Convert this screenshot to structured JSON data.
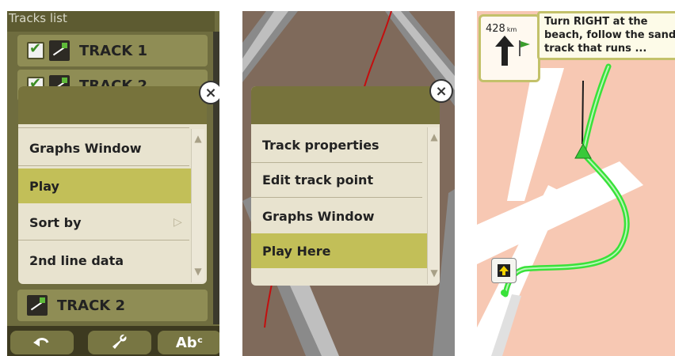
{
  "panel1": {
    "tracks_list_title": "Tracks list",
    "tracks": [
      {
        "label": "TRACK 1",
        "checked": true
      },
      {
        "label": "TRACK 2",
        "checked": true
      },
      {
        "label": "TRACK 2",
        "checked": false
      }
    ],
    "menu": {
      "items": [
        "Graphs Window",
        "Play",
        "Sort by",
        "2nd line data"
      ],
      "selected": "Play"
    },
    "bottom_buttons": [
      {
        "icon": "undo-icon"
      },
      {
        "icon": "wrench-icon"
      },
      {
        "icon": "text-icon",
        "label": "Abᶜ"
      }
    ]
  },
  "panel2": {
    "menu": {
      "items": [
        "Track properties",
        "Edit track point",
        "Graphs Window",
        "Play Here"
      ],
      "selected": "Play Here"
    }
  },
  "panel3": {
    "distance_value": "428",
    "distance_unit": "km",
    "instruction_text": "Turn RIGHT at the beach, follow the sand track that runs ...",
    "colors": {
      "route": "#39e23a",
      "road": "#ffffff",
      "background": "#f7c8b3"
    }
  }
}
